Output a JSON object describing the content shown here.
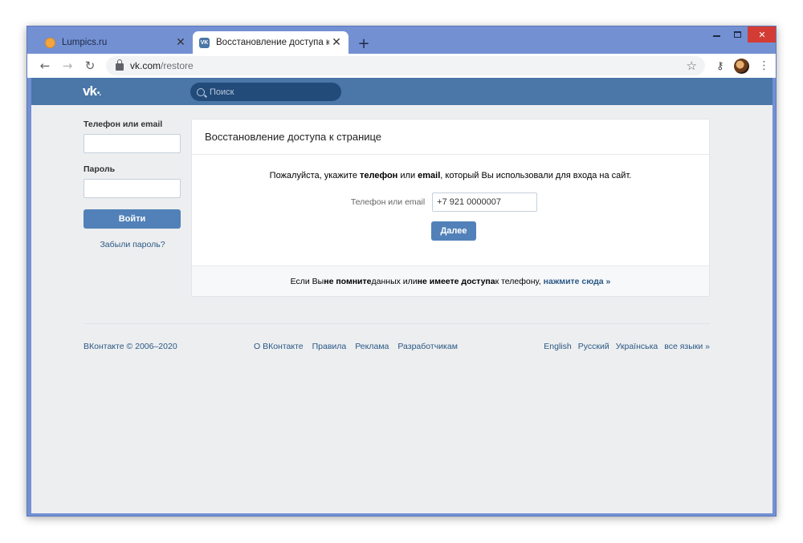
{
  "browser": {
    "tabs": [
      {
        "title": "Lumpics.ru",
        "active": false
      },
      {
        "title": "Восстановление доступа к стран",
        "active": true
      }
    ],
    "close_glyph": "✕",
    "newtab_glyph": "+",
    "url_host": "vk.com",
    "url_path": "/restore"
  },
  "vk": {
    "logo": "vk",
    "search_placeholder": "Поиск",
    "login": {
      "phone_label": "Телефон или email",
      "password_label": "Пароль",
      "login_button": "Войти",
      "forgot_link": "Забыли пароль?"
    },
    "restore": {
      "title": "Восстановление доступа к странице",
      "desc_part1": "Пожалуйста, укажите ",
      "desc_bold1": "телефон",
      "desc_part2": " или ",
      "desc_bold2": "email",
      "desc_part3": ", который Вы использовали для входа на сайт.",
      "field_label": "Телефон или email",
      "field_value": "+7 921 0000007",
      "next_button": "Далее",
      "foot_part1": "Если Вы ",
      "foot_bold1": "не помните",
      "foot_part2": " данных или ",
      "foot_bold2": "не имеете доступа",
      "foot_part3": " к телефону,",
      "foot_link": "нажмите сюда »"
    },
    "footer": {
      "copyright": "ВКонтакте © 2006–2020",
      "links": [
        "О ВКонтакте",
        "Правила",
        "Реклама",
        "Разработчикам"
      ],
      "languages": [
        "English",
        "Русский",
        "Українська",
        "все языки »"
      ]
    }
  },
  "colors": {
    "vk_blue": "#4a76a8",
    "button_blue": "#5181b8",
    "link_blue": "#2a5885",
    "window_frame": "#7390d3"
  }
}
